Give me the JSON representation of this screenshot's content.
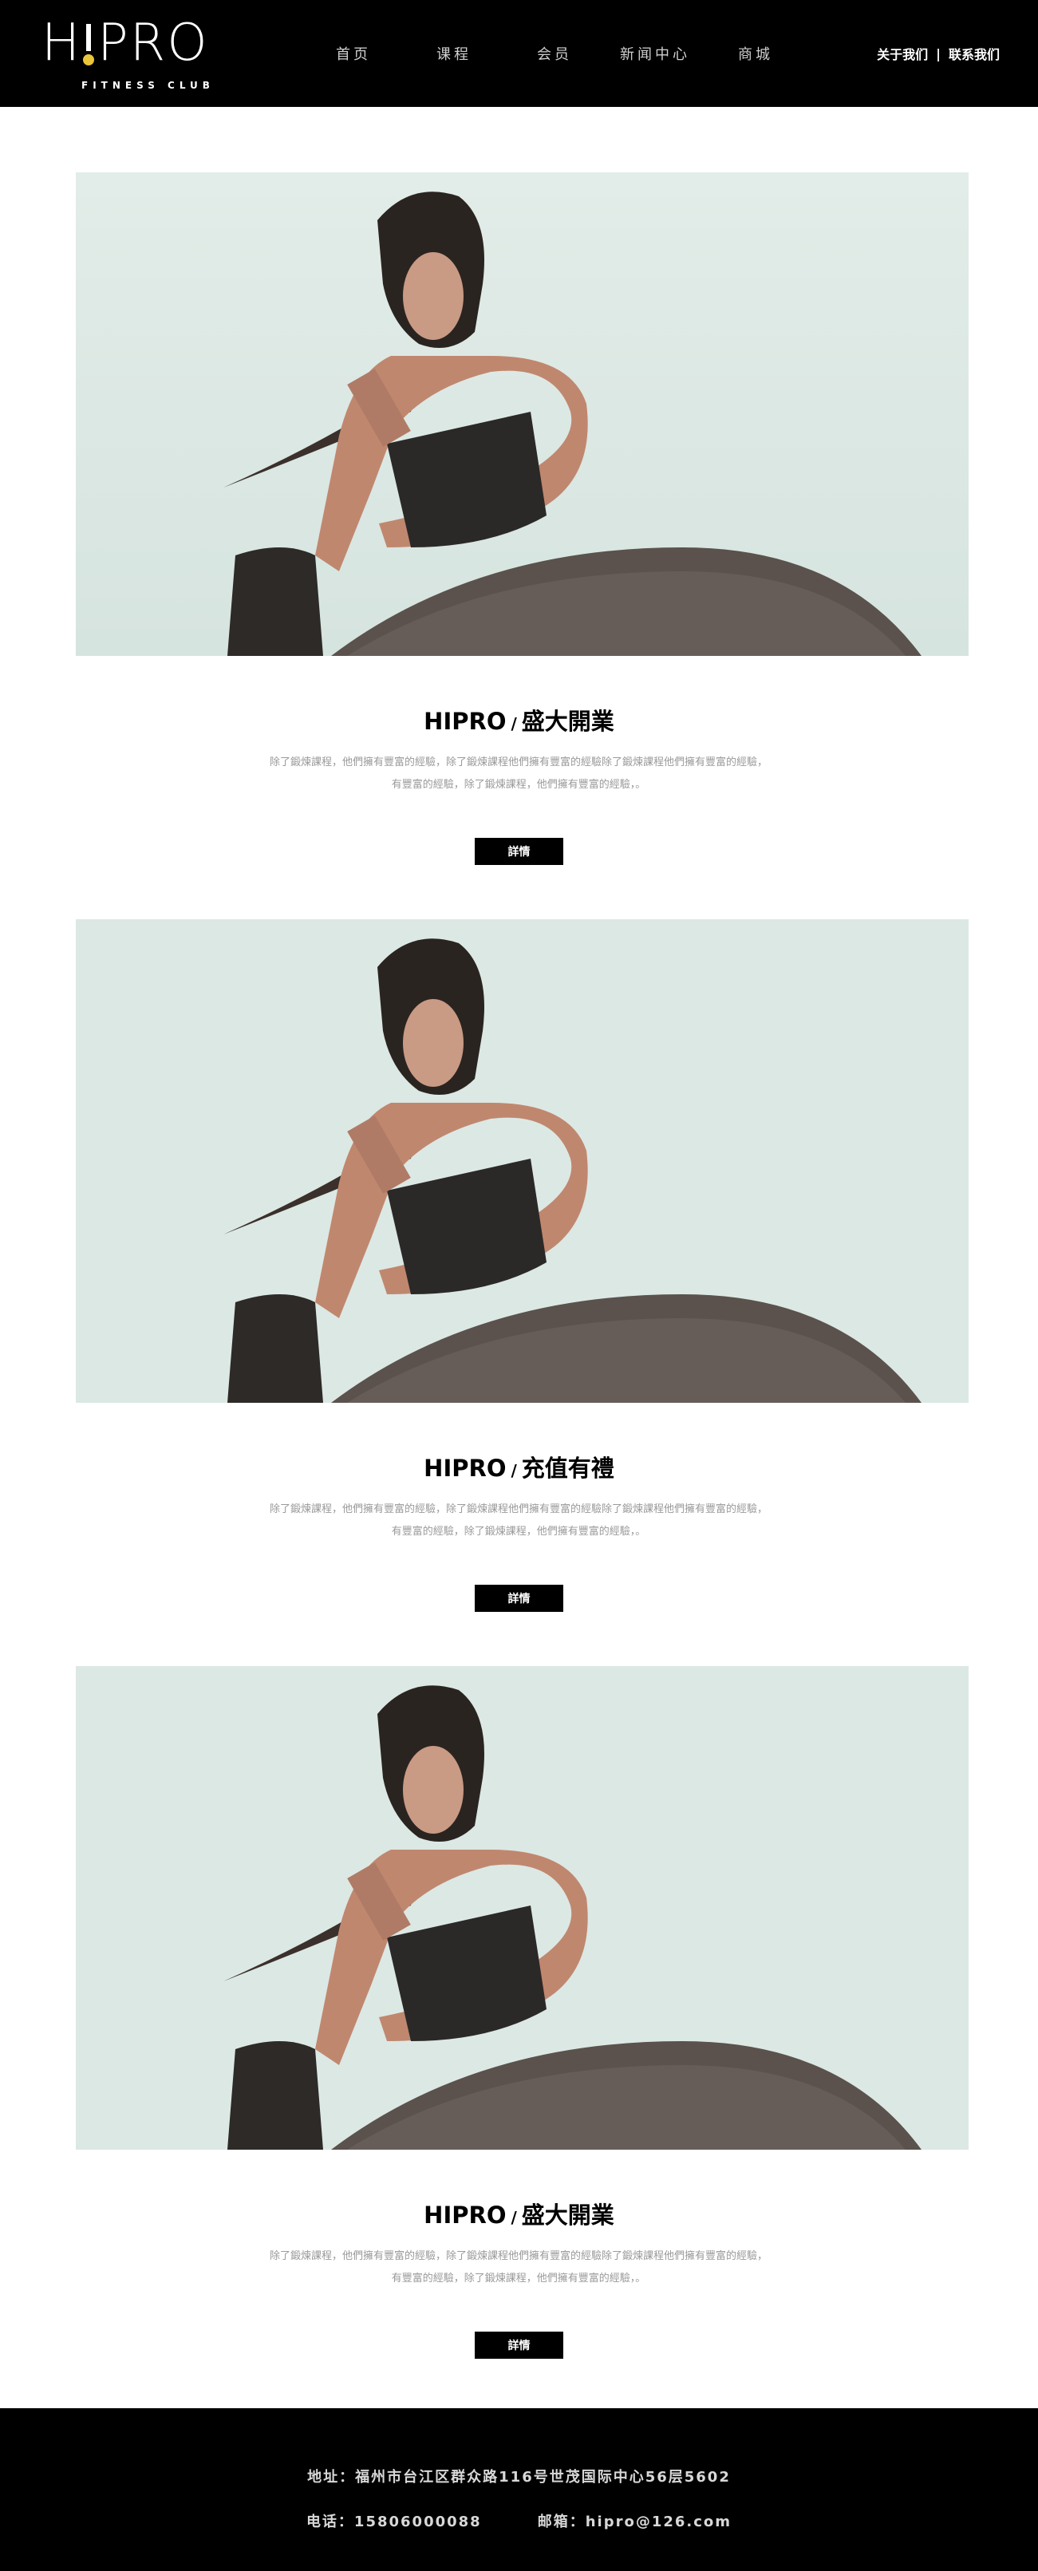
{
  "header": {
    "logo_text_h": "H",
    "logo_text_rest": "PRO",
    "logo_subtitle": "FITNESS CLUB",
    "nav": [
      {
        "label": "首页"
      },
      {
        "label": "课程"
      },
      {
        "label": "会员"
      },
      {
        "label": "新闻中心"
      },
      {
        "label": "商城"
      }
    ],
    "about_label": "关于我们",
    "divider": "|",
    "contact_label": "联系我们"
  },
  "articles": [
    {
      "brand": "HIPRO",
      "slash": "/",
      "headline": "盛大開業",
      "desc_line1": "除了鍛煉課程，他們擁有豐富的經驗，除了鍛煉課程他們擁有豐富的經驗除了鍛煉課程他們擁有豐富的經驗，",
      "desc_line2": "有豐富的經驗，除了鍛煉課程，他們擁有豐富的經驗，。",
      "button": "詳情"
    },
    {
      "brand": "HIPRO",
      "slash": "/",
      "headline": "充值有禮",
      "desc_line1": "除了鍛煉課程，他們擁有豐富的經驗，除了鍛煉課程他們擁有豐富的經驗除了鍛煉課程他們擁有豐富的經驗，",
      "desc_line2": "有豐富的經驗，除了鍛煉課程，他們擁有豐富的經驗，。",
      "button": "詳情"
    },
    {
      "brand": "HIPRO",
      "slash": "/",
      "headline": "盛大開業",
      "desc_line1": "除了鍛煉課程，他們擁有豐富的經驗，除了鍛煉課程他們擁有豐富的經驗除了鍛煉課程他們擁有豐富的經驗，",
      "desc_line2": "有豐富的經驗，除了鍛煉課程，他們擁有豐富的經驗，。",
      "button": "詳情"
    }
  ],
  "footer": {
    "address": "地址：福州市台江区群众路116号世茂国际中心56层5602",
    "phone": "电话：15806000088",
    "email": "邮箱：hipro@126.com"
  },
  "colors": {
    "background": "#ffffff",
    "header_bg": "#000000",
    "logo_accent": "#e9c63a",
    "photo_sky": "#dfeae6",
    "desc_text": "#9a9a9a"
  }
}
